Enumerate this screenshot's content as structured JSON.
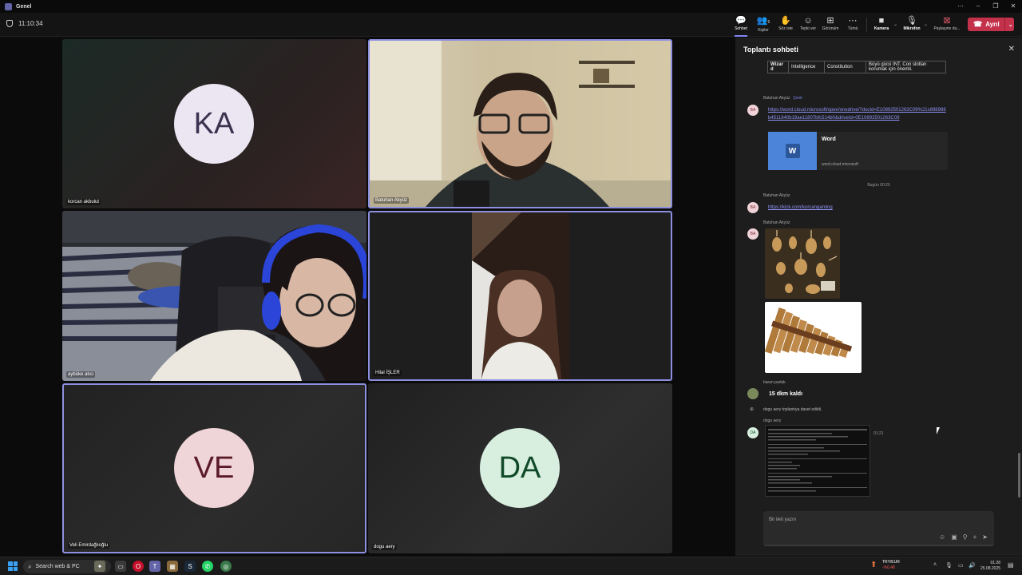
{
  "window": {
    "title": "Genel"
  },
  "toolbar": {
    "timer": "11:10:34",
    "buttons": [
      {
        "label": "Sohbet",
        "glyph": "💬",
        "icon": "chat-icon"
      },
      {
        "label": "Kişiler",
        "glyph": "👥",
        "icon": "people-icon",
        "badge": "6"
      },
      {
        "label": "Söz iste",
        "glyph": "✋",
        "icon": "raise-hand-icon"
      },
      {
        "label": "Tepki ver",
        "glyph": "☺",
        "icon": "react-icon"
      },
      {
        "label": "Görünüm",
        "glyph": "⊞",
        "icon": "view-icon"
      },
      {
        "label": "Tümü",
        "glyph": "⋯",
        "icon": "more-icon"
      },
      {
        "label": "Kamera",
        "glyph": "■",
        "icon": "camera-icon"
      },
      {
        "label": "Mikrofon",
        "glyph": "🎙",
        "icon": "mic-icon"
      },
      {
        "label": "Paylaşımı du...",
        "glyph": "⊠",
        "icon": "share-icon"
      }
    ],
    "leave_label": "Ayrıl"
  },
  "participants": [
    {
      "name": "korcan akbulut",
      "initials": "KA"
    },
    {
      "name": "Batuhan Akyüz"
    },
    {
      "name": "aybüke atıcı"
    },
    {
      "name": "Hilal İŞLER"
    },
    {
      "name": "Veli Emirdağlıoğlu",
      "initials": "VE"
    },
    {
      "name": "dogu aery",
      "initials": "DA"
    }
  ],
  "chat": {
    "title": "Toplantı sohbeti",
    "table_row": [
      "Wizar d",
      "Intelligence",
      "Constitution",
      "Büyü gücü INT, Con slotları korumak için önemli."
    ],
    "msg1": {
      "sender": "Batuhan Akyüz",
      "translate": "Çevir",
      "avatar": "BA",
      "link": "https://word.cloud.microsoft/open/onedrive/?docId=E10892501263C09%21s898986b4511840b19ae11807bfc514b0&driveId=0E10892501263C09",
      "card_title": "Word",
      "card_source": "word.cloud.microsoft"
    },
    "date_divider": "Bugün 00:20",
    "msg2": {
      "sender": "Batuhan Akyüz",
      "avatar": "BA",
      "link": "https://kick.com/korcangaming"
    },
    "msg3": {
      "sender": "Batuhan Akyüz",
      "avatar": "BA"
    },
    "msg4": {
      "sender": "baran parlak",
      "text": "15 dkm kaldı"
    },
    "system": "dogu aery toplantıya davet edildi.",
    "msg5": {
      "sender": "dogu aery",
      "avatar": "DA",
      "time": "01:21"
    },
    "compose_placeholder": "Bir ileti yazın"
  },
  "taskbar": {
    "search": "Search web & PC",
    "currency_pair": "TRY/EUR",
    "currency_change": "-%0,48",
    "time": "01:28",
    "date": "25.08.2025"
  },
  "colors": {
    "accent": "#7f85f5",
    "leave": "#c4314b"
  }
}
